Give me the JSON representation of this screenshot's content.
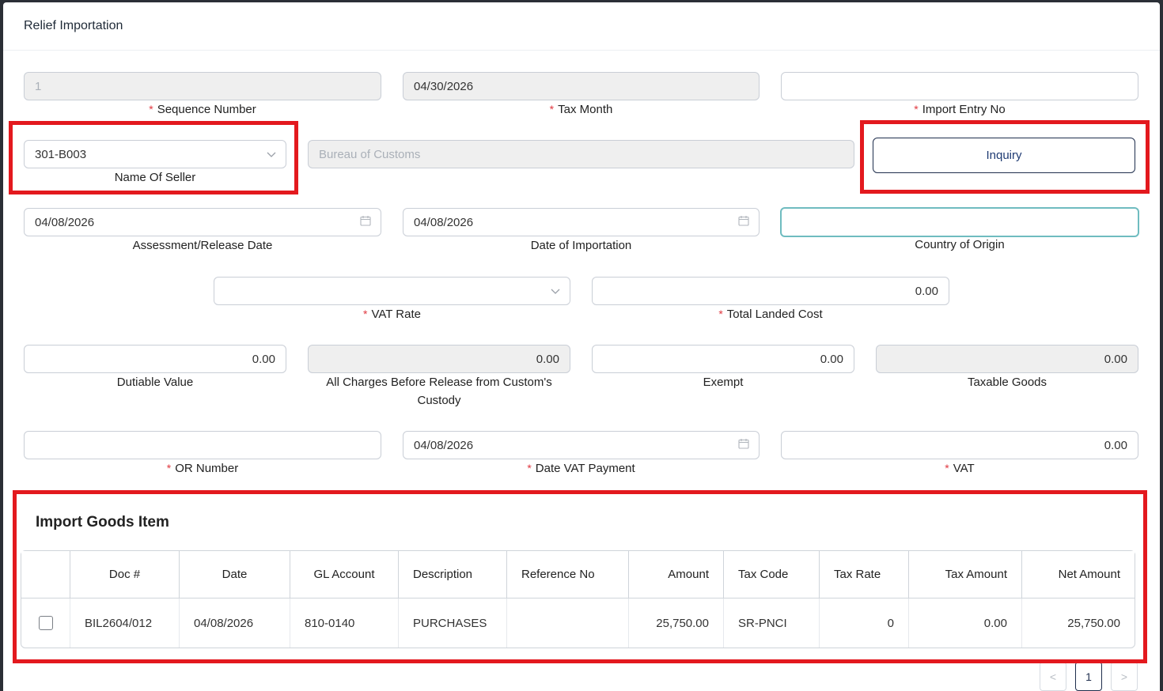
{
  "modal": {
    "title": "Relief Importation"
  },
  "fields": {
    "sequence_number": {
      "value": "1",
      "label": "Sequence Number"
    },
    "tax_month": {
      "value": "04/30/2026",
      "label": "Tax Month"
    },
    "import_entry_no": {
      "value": "",
      "label": "Import Entry No"
    },
    "name_of_seller": {
      "value": "301-B003",
      "label": "Name Of Seller"
    },
    "seller_name_display": {
      "placeholder": "Bureau of Customs"
    },
    "inquiry_button": "Inquiry",
    "assessment_release_date": {
      "value": "04/08/2026",
      "label": "Assessment/Release Date"
    },
    "date_of_importation": {
      "value": "04/08/2026",
      "label": "Date of Importation"
    },
    "country_of_origin": {
      "value": "",
      "label": "Country of Origin"
    },
    "vat_rate": {
      "value": "",
      "label": "VAT Rate"
    },
    "total_landed_cost": {
      "value": "0.00",
      "label": "Total Landed Cost"
    },
    "dutiable_value": {
      "value": "0.00",
      "label": "Dutiable Value"
    },
    "all_charges": {
      "value": "0.00",
      "label": "All Charges Before Release from Custom's Custody"
    },
    "exempt": {
      "value": "0.00",
      "label": "Exempt"
    },
    "taxable_goods": {
      "value": "0.00",
      "label": "Taxable Goods"
    },
    "or_number": {
      "value": "",
      "label": "OR Number"
    },
    "date_vat_payment": {
      "value": "04/08/2026",
      "label": "Date VAT Payment"
    },
    "vat": {
      "value": "0.00",
      "label": "VAT"
    }
  },
  "required_marker": "*",
  "import_goods": {
    "title": "Import Goods Item",
    "columns": [
      "",
      "Doc #",
      "Date",
      "GL Account",
      "Description",
      "Reference No",
      "Amount",
      "Tax Code",
      "Tax Rate",
      "Tax Amount",
      "Net Amount"
    ],
    "rows": [
      {
        "doc": "BIL2604/012",
        "date": "04/08/2026",
        "gl_account": "810-0140",
        "description": "PURCHASES",
        "reference_no": "",
        "amount": "25,750.00",
        "tax_code": "SR-PNCI",
        "tax_rate": "0",
        "tax_amount": "0.00",
        "net_amount": "25,750.00"
      }
    ]
  },
  "pagination": {
    "prev": "<",
    "current": "1",
    "next": ">"
  },
  "colors": {
    "highlight": "#e3191e",
    "required": "#e0373f",
    "primary": "#1f2e4d"
  }
}
